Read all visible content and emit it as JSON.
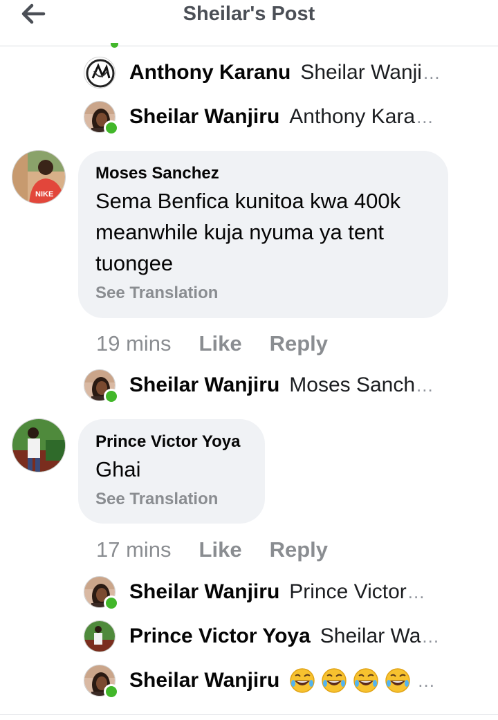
{
  "header": {
    "title": "Sheilar's Post",
    "back_icon": "arrow-left-icon"
  },
  "colors": {
    "online": "#42b72a",
    "bubble": "#f0f2f5",
    "muted": "#8a8d91",
    "title": "#4b4f56"
  },
  "replies_top": [
    {
      "name": "Anthony Karanu",
      "text": "Sheilar Wanji",
      "more": "..."
    },
    {
      "name": "Sheilar Wanjiru",
      "text": "Anthony Kara",
      "more": "..."
    }
  ],
  "comments": [
    {
      "author": "Moses Sanchez",
      "lines": [
        "Sema Benfica kunitoa kwa 400k",
        "meanwhile kuja nyuma ya tent",
        "tuongee"
      ],
      "translate": "See Translation",
      "time": "19 mins",
      "like": "Like",
      "reply": "Reply",
      "replies": [
        {
          "name": "Sheilar Wanjiru",
          "text": "Moses Sanch",
          "more": "..."
        }
      ]
    },
    {
      "author": "Prince Victor Yoya",
      "lines": [
        "Ghai"
      ],
      "translate": "See Translation",
      "time": "17 mins",
      "like": "Like",
      "reply": "Reply",
      "replies": [
        {
          "name": "Sheilar Wanjiru",
          "text": "Prince Victor",
          "more": "..."
        },
        {
          "name": "Prince Victor Yoya",
          "text": "Sheilar Wa",
          "more": "..."
        },
        {
          "name": "Sheilar Wanjiru",
          "text": "",
          "more": "...",
          "emoji": [
            "rofl-emoji-icon",
            "rofl-emoji-icon",
            "rofl-emoji-icon",
            "rofl-emoji-icon"
          ]
        }
      ]
    }
  ]
}
